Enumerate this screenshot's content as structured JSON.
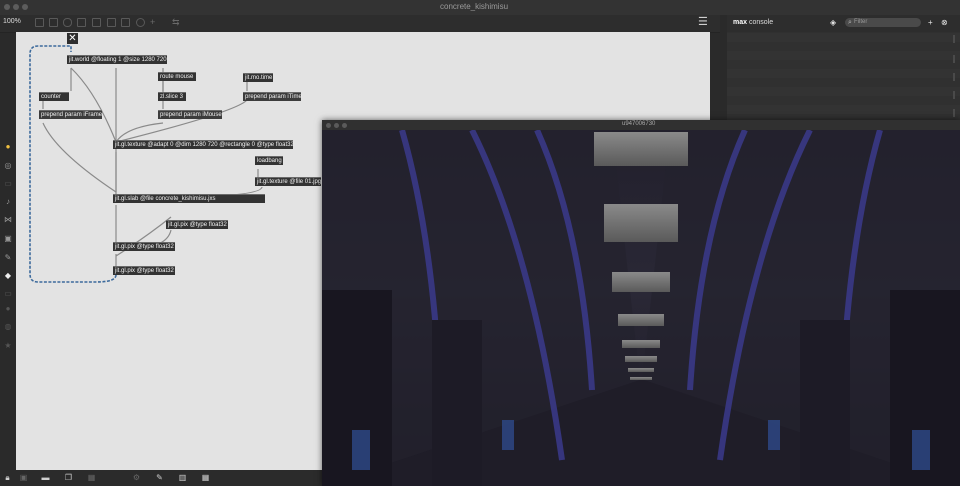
{
  "window": {
    "title": "concrete_kishimisu",
    "zoom": "100%"
  },
  "patch": {
    "objects": {
      "jit_world": "jit.world @floating 1 @size 1280 720",
      "route_mouse": "route mouse",
      "jit_mo_time": "jit.mo.time",
      "counter": "counter",
      "zl_slice": "zl.slice 3",
      "prepend_iframe": "prepend param iFrame",
      "prepend_imouse": "prepend param iMouse",
      "prepend_itime": "prepend param iTime",
      "jit_gl_texture_main": "jit.gl.texture @adapt 0 @dim 1280 720 @rectangle 0 @type float32",
      "loadbang": "loadbang",
      "jit_gl_texture_file": "jit.gl.texture @file 01.jpg",
      "jit_gl_slab": "jit.gl.slab @file concrete_kishimisu.jxs",
      "jit_gl_pix_1": "jit.gl.pix @type float32",
      "jit_gl_pix_2": "jit.gl.pix @type float32",
      "jit_gl_pix_3": "jit.gl.pix @type float32"
    },
    "close_glyph": "✕"
  },
  "console": {
    "title_bold": "max",
    "title_rest": " console",
    "filter_placeholder": "Filter"
  },
  "render_window": {
    "title": "u947006730"
  },
  "icons": {
    "toolbar": [
      "presentation-icon",
      "object-icon",
      "comment-icon",
      "message-icon",
      "button-icon",
      "toggle-icon",
      "number-icon",
      "dial-icon",
      "add-icon",
      "patcher-icon"
    ],
    "left": [
      "snippets-icon",
      "target-icon",
      "record-icon",
      "music-icon",
      "connect-icon",
      "image-icon",
      "paperclip-icon",
      "show-icon",
      "hide-icon",
      "info-icon",
      "globe-icon",
      "star-icon"
    ],
    "bottom": [
      "lock-icon",
      "presentation-mode-icon",
      "chat-icon",
      "windows-icon",
      "grid-icon",
      "inspector-icon",
      "wrench-icon",
      "columns-icon",
      "keyboard-icon"
    ]
  }
}
